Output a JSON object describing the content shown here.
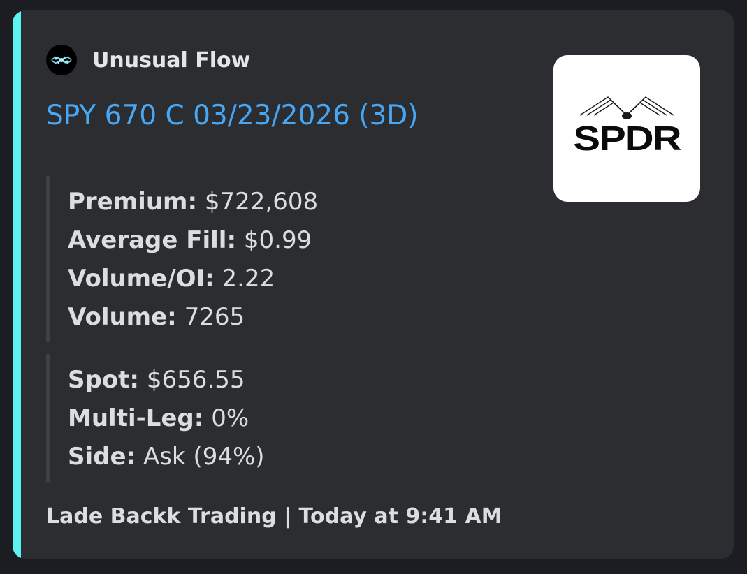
{
  "embed": {
    "accent_color": "#5cf2ee",
    "author": {
      "name": "Unusual Flow",
      "avatar_icon": "unusual-flow-logo-icon"
    },
    "title": "SPY 670 C 03/23/2026 (3D)",
    "title_color": "#47a7f5",
    "fields_primary": {
      "premium": {
        "label": "Premium:",
        "value": "$722,608"
      },
      "average_fill": {
        "label": "Average Fill:",
        "value": "$0.99"
      },
      "volume_oi": {
        "label": "Volume/OI:",
        "value": "2.22"
      },
      "volume": {
        "label": "Volume:",
        "value": "7265"
      }
    },
    "fields_secondary": {
      "spot": {
        "label": "Spot:",
        "value": "$656.55"
      },
      "multi_leg": {
        "label": "Multi-Leg:",
        "value": "0%"
      },
      "side": {
        "label": "Side:",
        "value": "Ask (94%)"
      }
    },
    "thumbnail": {
      "logo_text": "SPDR",
      "icon": "spdr-logo-icon"
    },
    "footer": {
      "text": "Lade Backk Trading | Today at 9:41 AM"
    }
  }
}
